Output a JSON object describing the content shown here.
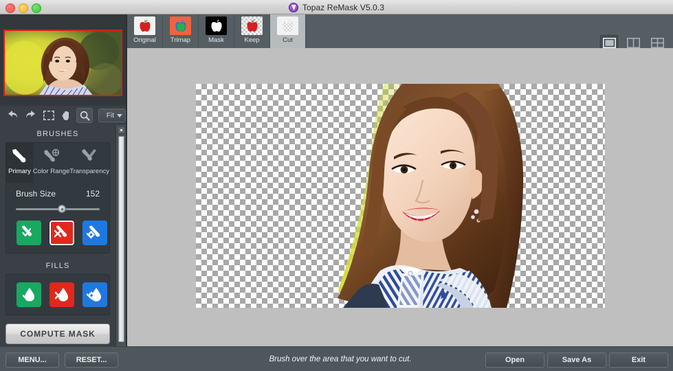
{
  "window": {
    "title": "Topaz ReMask V5.0.3",
    "logo_icon": "topaz-remask-logo-icon",
    "controls": {
      "close": "close-window-button",
      "minimize": "minimize-window-button",
      "maximize": "maximize-window-button"
    }
  },
  "toolstrip": {
    "tools": [
      {
        "name": "undo",
        "icon": "undo-arrow-icon"
      },
      {
        "name": "redo",
        "icon": "redo-arrow-icon"
      },
      {
        "name": "marquee-select",
        "icon": "marquee-select-icon"
      },
      {
        "name": "pan",
        "icon": "hand-icon"
      },
      {
        "name": "zoom",
        "icon": "magnifier-icon"
      }
    ],
    "zoom_value": "Fit",
    "zoom_caret_icon": "chevron-down-icon"
  },
  "brushes": {
    "section_title": "BRUSHES",
    "modes": [
      {
        "label": "Primary",
        "icon": "brush-primary-icon",
        "selected": true
      },
      {
        "label": "Color Range",
        "icon": "brush-color-range-icon",
        "selected": false
      },
      {
        "label": "Transparency",
        "icon": "brush-transparency-icon",
        "selected": false
      }
    ],
    "brush_size_label": "Brush Size",
    "brush_size_value": "152",
    "brush_size_percent": 55,
    "actions": [
      {
        "name": "keep-brush",
        "color": "#18a861",
        "icon": "brush-check-icon",
        "selected": false
      },
      {
        "name": "cut-brush",
        "color": "#e0291c",
        "icon": "brush-x-icon",
        "selected": true
      },
      {
        "name": "compute-brush",
        "color": "#1f78e0",
        "icon": "brush-gear-icon",
        "selected": false
      }
    ]
  },
  "fills": {
    "section_title": "FILLS",
    "actions": [
      {
        "name": "keep-fill",
        "color": "#18a861",
        "icon": "droplet-check-icon",
        "selected": false
      },
      {
        "name": "cut-fill",
        "color": "#e0291c",
        "icon": "droplet-x-icon",
        "selected": false
      },
      {
        "name": "compute-fill",
        "color": "#1f78e0",
        "icon": "droplet-gear-icon",
        "selected": false
      }
    ]
  },
  "compute_mask_label": "COMPUTE MASK",
  "tabs": [
    {
      "label": "Original",
      "icon": "apple-original-icon",
      "active": false
    },
    {
      "label": "Trimap",
      "icon": "apple-trimap-icon",
      "active": false
    },
    {
      "label": "Mask",
      "icon": "apple-mask-icon",
      "active": false
    },
    {
      "label": "Keep",
      "icon": "apple-keep-icon",
      "active": false
    },
    {
      "label": "Cut",
      "icon": "apple-cut-icon",
      "active": true
    }
  ],
  "view_modes": [
    {
      "name": "single-view",
      "icon": "single-pane-icon",
      "selected": true
    },
    {
      "name": "split-view",
      "icon": "two-pane-icon",
      "selected": false
    },
    {
      "name": "quad-view",
      "icon": "four-pane-icon",
      "selected": false
    }
  ],
  "canvas": {
    "background": "#bfbfbf",
    "transparency_checkerboard": true,
    "image_description": "cut-out portrait of smiling woman with brown hair, blue-and-white striped shirt and backpack on transparent background"
  },
  "thumbnail": {
    "selection_border_color": "#e01b12",
    "image_description": "portrait of smiling woman against blurred yellow-green foliage background"
  },
  "bottom": {
    "menu_label": "MENU...",
    "reset_label": "RESET...",
    "status": "Brush over the area that you want to cut.",
    "open_label": "Open",
    "save_as_label": "Save As",
    "exit_label": "Exit"
  }
}
